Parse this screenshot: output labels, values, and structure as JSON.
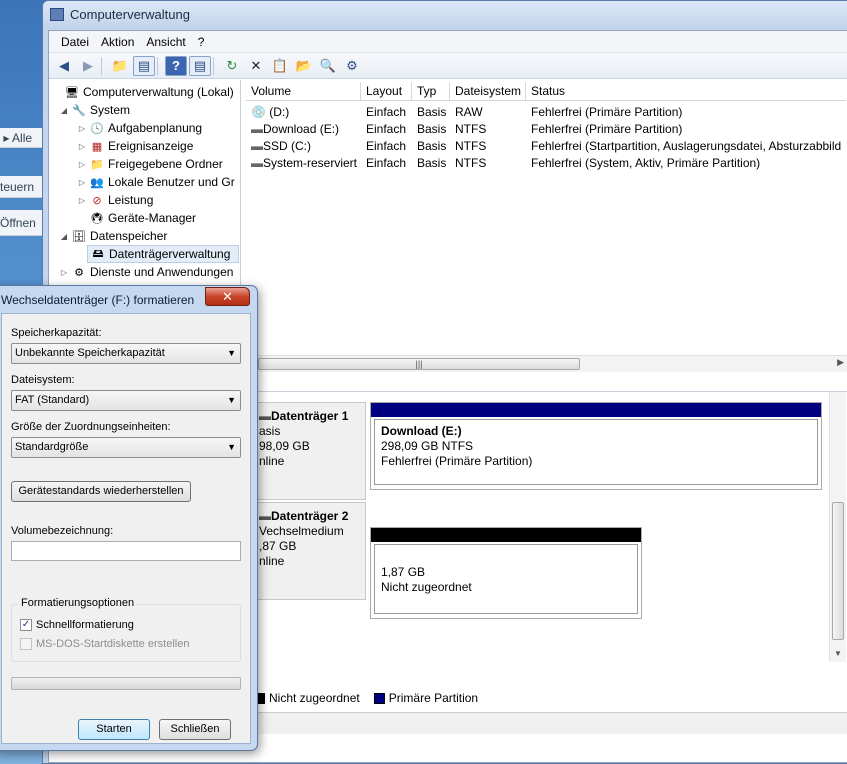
{
  "background": {
    "strips": [
      "Alle",
      "teuern",
      "Öffnen"
    ]
  },
  "window": {
    "title": "Computerverwaltung",
    "menu": [
      "Datei",
      "Aktion",
      "Ansicht",
      "?"
    ]
  },
  "tree": {
    "items": [
      {
        "label": "Computerverwaltung (Lokal)",
        "icon": "computer-icon"
      },
      {
        "label": "System",
        "icon": "tools-icon"
      },
      {
        "label": "Aufgabenplanung",
        "icon": "clock-icon"
      },
      {
        "label": "Ereignisanzeige",
        "icon": "event-log-icon"
      },
      {
        "label": "Freigegebene Ordner",
        "icon": "shared-folder-icon"
      },
      {
        "label": "Lokale Benutzer und Gr",
        "icon": "users-icon"
      },
      {
        "label": "Leistung",
        "icon": "performance-icon"
      },
      {
        "label": "Geräte-Manager",
        "icon": "device-manager-icon"
      },
      {
        "label": "Datenspeicher",
        "icon": "storage-icon"
      },
      {
        "label": "Datenträgerverwaltung",
        "icon": "disk-management-icon"
      },
      {
        "label": "Dienste und Anwendungen",
        "icon": "services-icon"
      }
    ]
  },
  "volumes": {
    "columns": [
      "Volume",
      "Layout",
      "Typ",
      "Dateisystem",
      "Status"
    ],
    "rows": [
      [
        "(D:)",
        "Einfach",
        "Basis",
        "RAW",
        "Fehlerfrei (Primäre Partition)"
      ],
      [
        "Download (E:)",
        "Einfach",
        "Basis",
        "NTFS",
        "Fehlerfrei (Primäre Partition)"
      ],
      [
        "SSD (C:)",
        "Einfach",
        "Basis",
        "NTFS",
        "Fehlerfrei (Startpartition, Auslagerungsdatei, Absturzabbild"
      ],
      [
        "System-reserviert",
        "Einfach",
        "Basis",
        "NTFS",
        "Fehlerfrei (System, Aktiv, Primäre Partition)"
      ]
    ]
  },
  "disks": [
    {
      "name": "Datenträger 1",
      "type": "asis",
      "size": "98,09 GB",
      "state": "nline",
      "partition": {
        "title": "Download  (E:)",
        "line1": "298,09 GB NTFS",
        "line2": "Fehlerfrei (Primäre Partition)",
        "color": "#000080"
      }
    },
    {
      "name": "Datenträger 2",
      "type": "Vechselmedium",
      "size": ",87 GB",
      "state": "nline",
      "partition": {
        "title": "",
        "line1": "1,87 GB",
        "line2": "Nicht zugeordnet",
        "color": "#000000"
      }
    }
  ],
  "legend": [
    {
      "label": "Nicht zugeordnet",
      "color": "#000000"
    },
    {
      "label": "Primäre Partition",
      "color": "#000080"
    }
  ],
  "dialog": {
    "title": "Wechseldatenträger (F:) formatieren",
    "close_label": "x",
    "capacity_label": "Speicherkapazität:",
    "capacity_value": "Unbekannte Speicherkapazität",
    "fs_label": "Dateisystem:",
    "fs_value": "FAT (Standard)",
    "alloc_label": "Größe der Zuordnungseinheiten:",
    "alloc_value": "Standardgröße",
    "restore_label": "Gerätestandards wiederherstellen",
    "volume_label": "Volumebezeichnung:",
    "volume_value": "",
    "options_label": "Formatierungsoptionen",
    "quick_label": "Schnellformatierung",
    "quick_checked": true,
    "msdos_label": "MS-DOS-Startdiskette erstellen",
    "msdos_checked": false,
    "progress": 0,
    "start_label": "Starten",
    "close_button_label": "Schließen"
  }
}
